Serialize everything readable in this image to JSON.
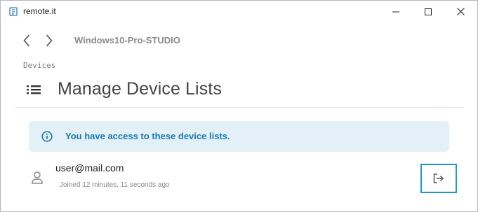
{
  "window": {
    "title": "remote.it",
    "icons": {
      "app": "remoteit-app-icon",
      "minimize": "minimize-icon",
      "maximize": "maximize-icon",
      "close": "close-icon"
    }
  },
  "header": {
    "device_name": "Windows10-Pro-STUDIO",
    "icons": {
      "back": "chevron-left-icon",
      "forward": "chevron-right-icon"
    }
  },
  "breadcrumb": "Devices",
  "page": {
    "title": "Manage Device Lists",
    "icon": "list-icon"
  },
  "alert": {
    "text": "You have access to these device lists.",
    "icon": "info-icon",
    "color": "#1a78b4",
    "background": "#e3f0f8"
  },
  "user": {
    "email": "user@mail.com",
    "joined": "Joined 12 minutes, 11 seconds ago",
    "icon": "person-icon",
    "action_icon": "leave-icon"
  },
  "colors": {
    "accent": "#2196d3"
  }
}
